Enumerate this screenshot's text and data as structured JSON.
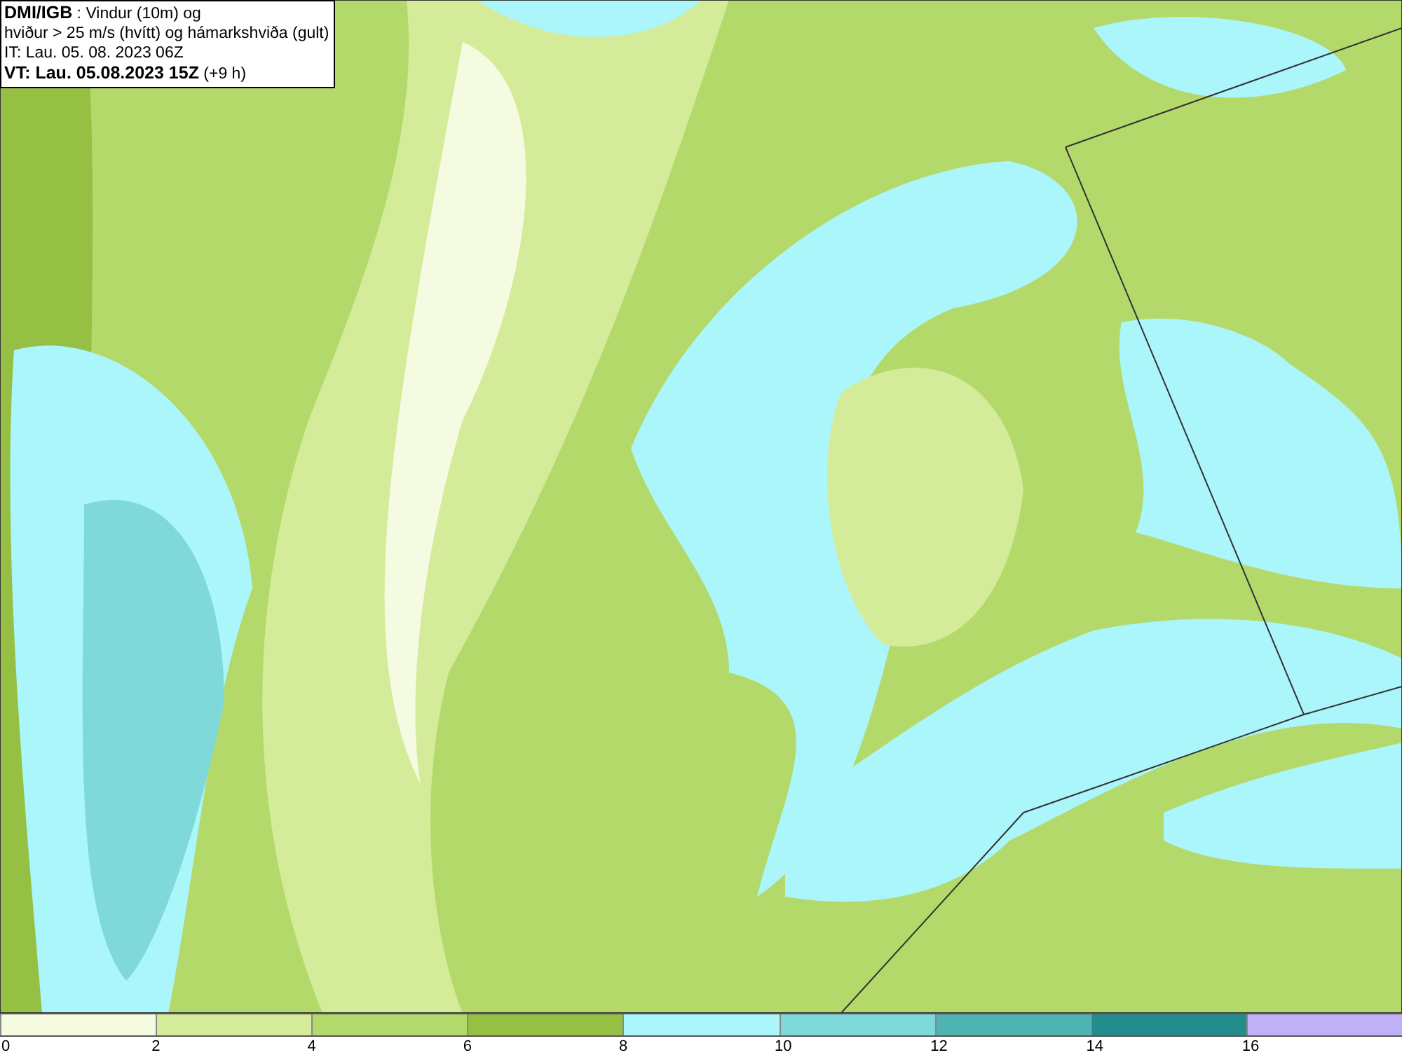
{
  "header": {
    "lines": [
      "**DMI/IGB** : Vindur (10m) og",
      "hviður > 25 m/s (hvítt) og hámarkshviða (gult)",
      "IT: Lau. 05. 08. 2023 06Z",
      "**VT: Lau. 05.08.2023 15Z** (+9 h)"
    ]
  },
  "legend": {
    "segments": [
      {
        "color": "#f5fbe0",
        "label": "0"
      },
      {
        "color": "#d4eb9a",
        "label": "2"
      },
      {
        "color": "#b4d96b",
        "label": "4"
      },
      {
        "color": "#96c043",
        "label": "6"
      },
      {
        "color": "#aaf6fb",
        "label": "8"
      },
      {
        "color": "#7fd9d9",
        "label": "10"
      },
      {
        "color": "#50b3b3",
        "label": "12"
      },
      {
        "color": "#238c8c",
        "label": "14"
      },
      {
        "color": "#c0b0f8",
        "label": "16"
      }
    ]
  }
}
